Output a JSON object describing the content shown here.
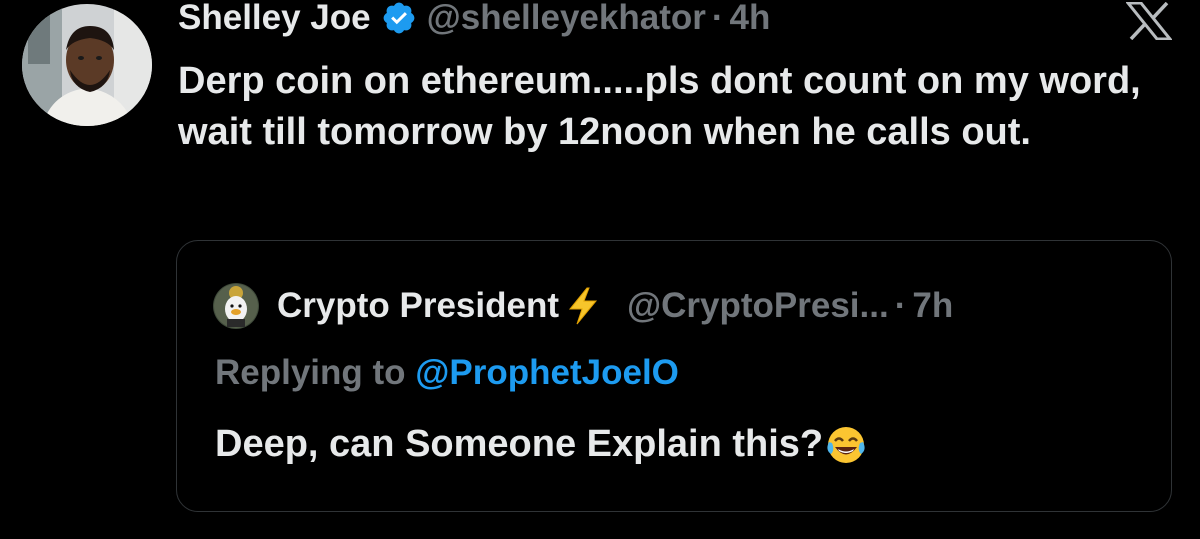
{
  "tweet": {
    "author": {
      "display_name": "Shelley Joe",
      "handle": "@shelleyekhator",
      "verified_icon": "verified-badge-icon",
      "avatar": "avatar"
    },
    "separator": "·",
    "time": "4h",
    "text": "Derp coin on ethereum.....pls dont count on my word, wait till tomorrow by 12noon when he calls out.",
    "platform_icon": "x-logo-icon"
  },
  "quote": {
    "author": {
      "display_name": "Crypto President",
      "name_emoji_icon": "lightning-bolt-icon",
      "handle": "@CryptoPresi...",
      "avatar": "quote-avatar"
    },
    "separator": "·",
    "time": "7h",
    "replying_prefix": "Replying to",
    "replying_handle": "@ProphetJoelO",
    "text": "Deep, can Someone Explain this?",
    "text_emoji_icon": "tears-of-joy-emoji-icon"
  },
  "colors": {
    "background": "#000000",
    "primary_text": "#e7e9ea",
    "secondary_text": "#71767b",
    "link": "#1d9bf0",
    "verified": "#1d9bf0",
    "border": "#2f3336"
  }
}
